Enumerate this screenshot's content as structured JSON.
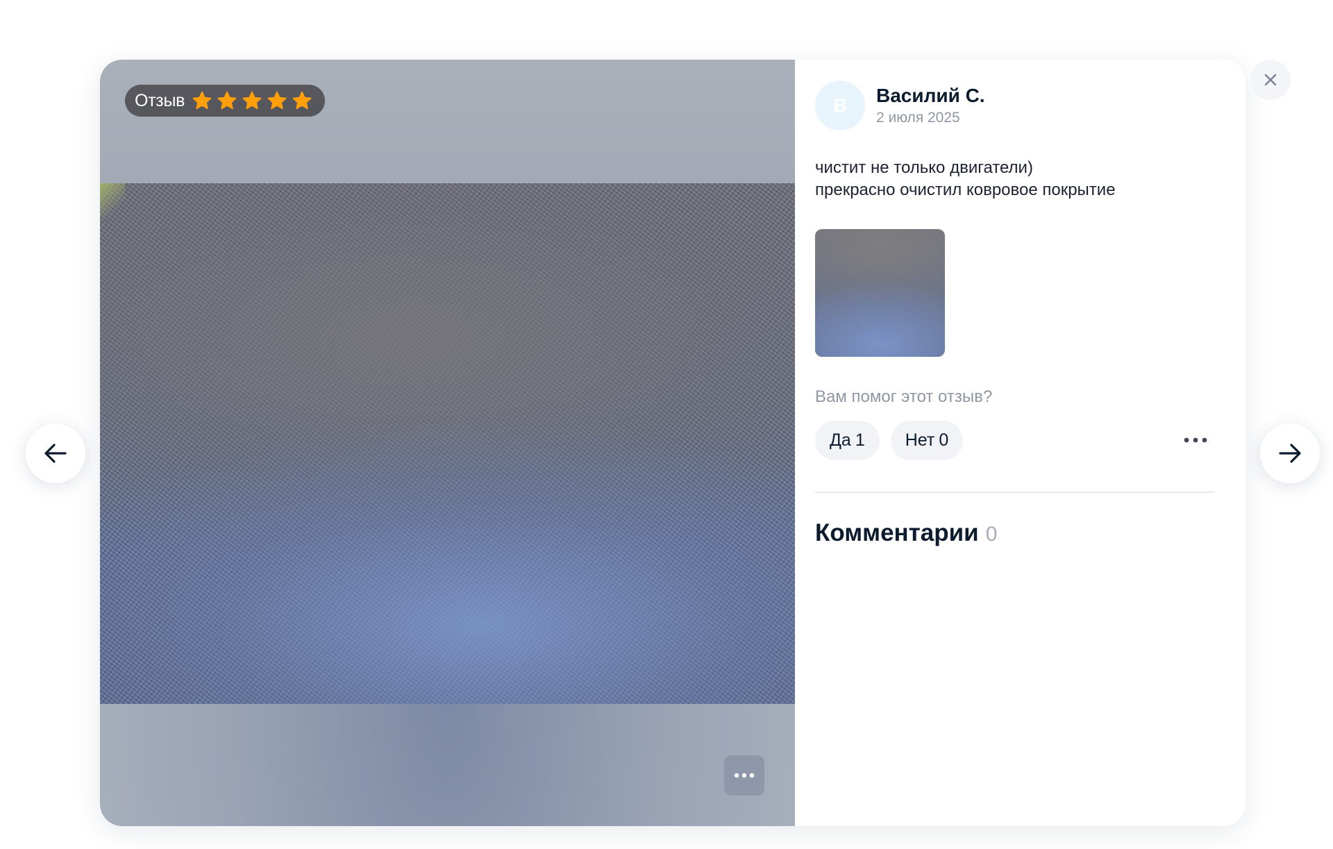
{
  "media": {
    "badge_label": "Отзыв",
    "rating": 5,
    "rating_max": 5,
    "star_color": "#ff9f0a",
    "more_icon": "more-horizontal-icon"
  },
  "review": {
    "avatar_letter": "В",
    "author": "Василий С.",
    "date": "2 июля 2025",
    "text_lines": [
      "чистит не только двигатели)",
      "прекрасно очистил ковровое покрытие"
    ],
    "helpful_question": "Вам помог этот отзыв?",
    "yes_label": "Да",
    "yes_count": "1",
    "no_label": "Нет",
    "no_count": "0"
  },
  "comments": {
    "title": "Комментарии",
    "count": "0"
  },
  "controls": {
    "close_icon": "close-icon",
    "prev_icon": "arrow-left-icon",
    "next_icon": "arrow-right-icon"
  }
}
